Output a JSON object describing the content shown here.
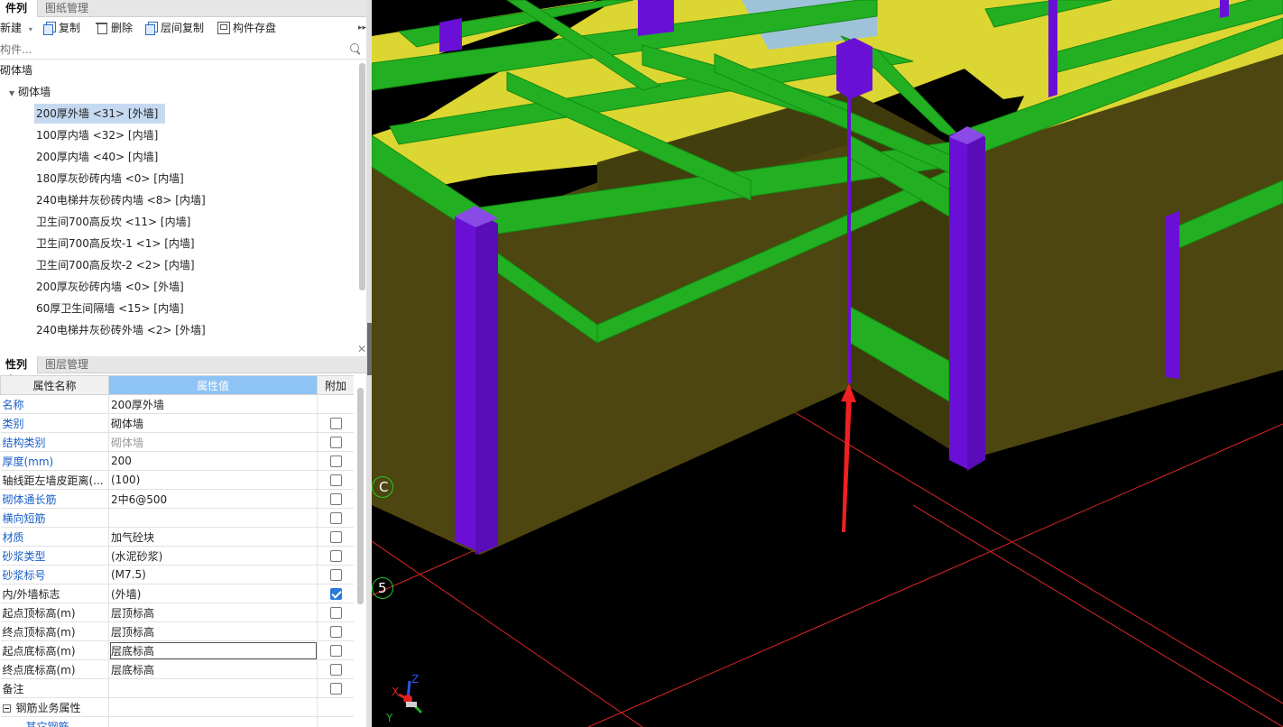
{
  "component_panel": {
    "tabs": [
      "件列表",
      "图纸管理"
    ],
    "toolbar": {
      "new_label": "新建",
      "copy_label": "复制",
      "delete_label": "删除",
      "floor_copy_label": "层间复制",
      "save_label": "构件存盘"
    },
    "search": {
      "placeholder": "构件..."
    },
    "tree": {
      "root": "砌体墙",
      "group": "砌体墙",
      "items": [
        "200厚外墙 <31> [外墙]",
        "100厚内墙 <32> [内墙]",
        "200厚内墙 <40> [内墙]",
        "180厚灰砂砖内墙 <0> [内墙]",
        "240电梯井灰砂砖内墙 <8> [内墙]",
        "卫生间700高反坎 <11> [内墙]",
        "卫生间700高反坎-1 <1> [内墙]",
        "卫生间700高反坎-2 <2> [内墙]",
        "200厚灰砂砖内墙 <0> [外墙]",
        "60厚卫生间隔墙 <15> [内墙]",
        "240电梯井灰砂砖外墙 <2> [外墙]"
      ],
      "selected_index": 0
    }
  },
  "properties_panel": {
    "tabs": [
      "性列表",
      "图层管理"
    ],
    "headers": {
      "name": "属性名称",
      "value": "属性值",
      "extra": "附加"
    },
    "rows": [
      {
        "name": "名称",
        "value": "200厚外墙",
        "checkbox": null,
        "name_color": "blue"
      },
      {
        "name": "类别",
        "value": "砌体墙",
        "checkbox": false,
        "name_color": "blue"
      },
      {
        "name": "结构类别",
        "value": "砌体墙",
        "checkbox": false,
        "name_color": "blue",
        "value_gray": true
      },
      {
        "name": "厚度(mm)",
        "value": "200",
        "checkbox": false,
        "name_color": "blue"
      },
      {
        "name": "轴线距左墙皮距离(...",
        "value": "(100)",
        "checkbox": false,
        "name_color": "dark"
      },
      {
        "name": "砌体通长筋",
        "value": "2中6@500",
        "checkbox": false,
        "name_color": "blue"
      },
      {
        "name": "横向短筋",
        "value": "",
        "checkbox": false,
        "name_color": "blue"
      },
      {
        "name": "材质",
        "value": "加气砼块",
        "checkbox": false,
        "name_color": "blue"
      },
      {
        "name": "砂浆类型",
        "value": "(水泥砂浆)",
        "checkbox": false,
        "name_color": "blue"
      },
      {
        "name": "砂浆标号",
        "value": "(M7.5)",
        "checkbox": false,
        "name_color": "blue"
      },
      {
        "name": "内/外墙标志",
        "value": "(外墙)",
        "checkbox": true,
        "name_color": "dark"
      },
      {
        "name": "起点顶标高(m)",
        "value": "层顶标高",
        "checkbox": false,
        "name_color": "dark"
      },
      {
        "name": "终点顶标高(m)",
        "value": "层顶标高",
        "checkbox": false,
        "name_color": "dark"
      },
      {
        "name": "起点底标高(m)",
        "value": "层底标高",
        "checkbox": false,
        "name_color": "dark",
        "editing": true
      },
      {
        "name": "终点底标高(m)",
        "value": "层底标高",
        "checkbox": false,
        "name_color": "dark"
      },
      {
        "name": "备注",
        "value": "",
        "checkbox": false,
        "name_color": "dark"
      },
      {
        "name": "钢筋业务属性",
        "value": "",
        "checkbox": null,
        "name_color": "dark",
        "group": true
      },
      {
        "name": "其它钢筋",
        "value": "",
        "checkbox": null,
        "name_color": "blue"
      }
    ]
  },
  "viewport": {
    "axis_labels": [
      "C",
      "5"
    ],
    "gizmo": {
      "x": "X",
      "y": "Y",
      "z": "Z"
    },
    "colors": {
      "background": "#000000",
      "wall": "#4d4610",
      "slab": "#dcd632",
      "beam": "#22b022",
      "column": "#6a10d6",
      "grid": "#e0262a",
      "arrow": "#f02020"
    }
  }
}
